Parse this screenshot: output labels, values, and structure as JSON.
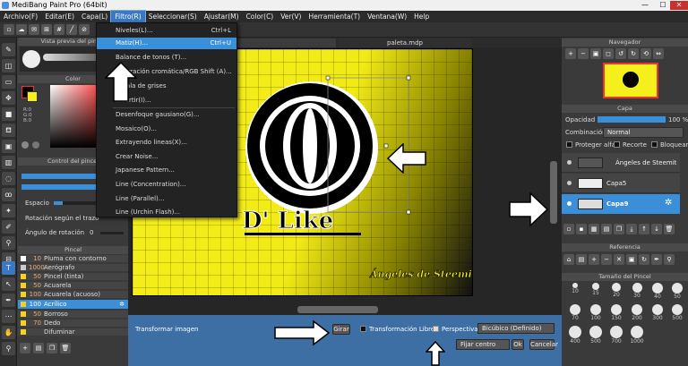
{
  "window": {
    "title": "MediBang Paint Pro (64bit)",
    "minimize": "—",
    "maximize": "☐",
    "close": "✕"
  },
  "menubar": [
    {
      "label": "Archivo(F)"
    },
    {
      "label": "Editar(E)"
    },
    {
      "label": "Capa(L)"
    },
    {
      "label": "Filtro(R)"
    },
    {
      "label": "Seleccionar(S)"
    },
    {
      "label": "Ajustar(M)"
    },
    {
      "label": "Color(C)"
    },
    {
      "label": "Ver(V)"
    },
    {
      "label": "Herramienta(T)"
    },
    {
      "label": "Ventana(W)"
    },
    {
      "label": "Help"
    }
  ],
  "filter_menu": [
    {
      "label": "Niveles(L)...",
      "shortcut": "Ctrl+L"
    },
    {
      "label": "Matiz(H)...",
      "shortcut": "Ctrl+U"
    },
    {
      "label": "Balance de tonos (T)..."
    },
    {
      "label": "Aberración cromática/RGB Shift (A)..."
    },
    {
      "label": "Escala de grises"
    },
    {
      "label": "Invertir(I)..."
    },
    {
      "label": "Desenfoque gausiano(G)..."
    },
    {
      "label": "Mosaico(O)..."
    },
    {
      "label": "Extrayendo lineas(X)..."
    },
    {
      "label": "Crear Noise..."
    },
    {
      "label": "Japanese Pattern..."
    },
    {
      "label": "Line (Concentration)..."
    },
    {
      "label": "Line (Parallel)..."
    },
    {
      "label": "Line (Urchin Flash)..."
    }
  ],
  "left": {
    "brush_preview_title": "Vista previa del pincel",
    "color_title": "Color",
    "color_values": [
      "R:0",
      "G:0",
      "B:0"
    ],
    "brush_control_title": "Control del pincel",
    "spacing_label": "Espacio",
    "rotation_label": "Rotación según el trazo",
    "rotation_angle_label": "Ángulo de rotación",
    "rotation_angle_value": "0",
    "brush_panel_title": "Pincel",
    "brushes": [
      {
        "size": "10",
        "name": "Pluma con contorno",
        "color": "#ffffff"
      },
      {
        "size": "1000",
        "name": "Aerógrafo",
        "color": "#cccccc"
      },
      {
        "size": "50",
        "name": "Pincel (tinta)",
        "color": "#f7d21c"
      },
      {
        "size": "50",
        "name": "Acuarela",
        "color": "#f7d21c"
      },
      {
        "size": "100",
        "name": "Acuarela (acuoso)",
        "color": "#f7d21c"
      },
      {
        "size": "100",
        "name": "Acrílico",
        "color": "#f7d21c",
        "selected": true
      },
      {
        "size": "50",
        "name": "Borroso",
        "color": "#f7d21c"
      },
      {
        "size": "70",
        "name": "Dedo",
        "color": "#f7d21c"
      },
      {
        "size": "",
        "name": "Difuminar",
        "color": "#f7d21c"
      }
    ]
  },
  "canvas": {
    "tab1": "",
    "tab2": "paleta.mdp",
    "title_text": "D' Like",
    "signature": "Ángeles de Steemit"
  },
  "right": {
    "navigator_title": "Navegador",
    "layer_title": "Capa",
    "opacity_label": "Opacidad",
    "opacity_value": "100 %",
    "blend_label": "Combinación",
    "blend_value": "Normal",
    "protect_alpha": "Proteger alfa",
    "clip": "Recorte",
    "lock": "Bloquear",
    "layers": [
      {
        "name": "Ángeles de Steemit"
      },
      {
        "name": "Capa5"
      },
      {
        "name": "Capa9",
        "selected": true
      }
    ],
    "reference_title": "Referencia",
    "brush_size_title": "Tamaño del Pincel",
    "sizes": [
      "10",
      "15",
      "20",
      "30",
      "40",
      "50",
      "70",
      "100",
      "150",
      "200",
      "300",
      "500",
      "400",
      "500",
      "700",
      "1000"
    ]
  },
  "transform": {
    "label": "Transformar imagen",
    "apply_button": "Girar",
    "free_transform": "Transformación Libre",
    "perspective": "Perspectiva",
    "interpolation": "Bicúbico (Definido)",
    "center": "Fijar centro",
    "ok": "Ok",
    "cancel": "Cancelar"
  },
  "colors": {
    "accent": "#3a8fd8",
    "canvas_yellow": "#f5ef1c",
    "panel": "#3a3a3a"
  }
}
